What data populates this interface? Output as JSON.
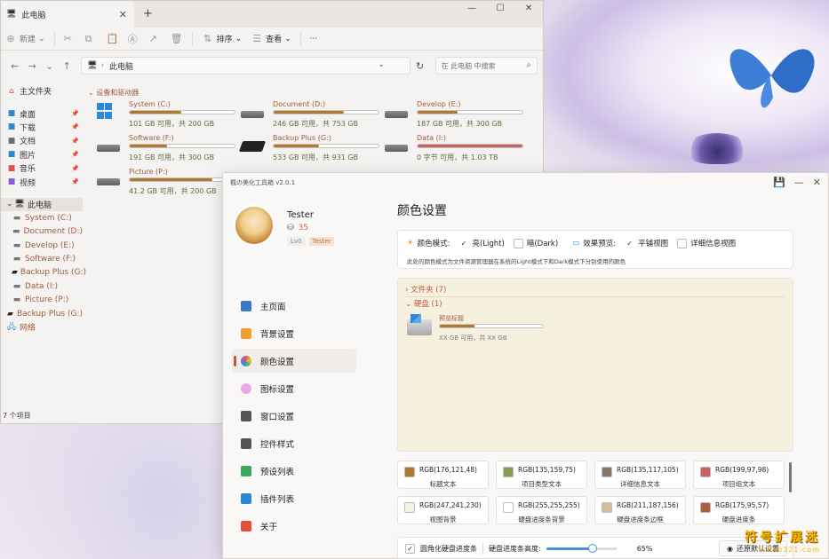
{
  "explorer": {
    "tab_title": "此电脑",
    "new_tab": "+",
    "close": "✕",
    "toolbar": {
      "new_label": "新建",
      "sort_label": "排序",
      "view_label": "查看",
      "more": "···"
    },
    "address": "此电脑",
    "search_placeholder": "在 此电脑 中搜索",
    "sidebar": {
      "home": "主文件夹",
      "quick": [
        {
          "label": "桌面",
          "icon": "desktop-icon",
          "color": "#2b88d8"
        },
        {
          "label": "下载",
          "icon": "download-icon",
          "color": "#2b88d8"
        },
        {
          "label": "文档",
          "icon": "document-icon",
          "color": "#6d6d6d"
        },
        {
          "label": "图片",
          "icon": "picture-icon",
          "color": "#2b88d8"
        },
        {
          "label": "音乐",
          "icon": "music-icon",
          "color": "#e0534a"
        },
        {
          "label": "视频",
          "icon": "video-icon",
          "color": "#8a5ad8"
        }
      ],
      "this_pc": "此电脑",
      "drives": [
        "System (C:)",
        "Document (D:)",
        "Develop (E:)",
        "Software (F:)",
        "Backup Plus (G:)",
        "Data (I:)",
        "Picture (P:)"
      ],
      "extra_drive": "Backup Plus (G:)",
      "network": "网络"
    },
    "group_header": "设备和驱动器",
    "drives": [
      {
        "name": "System (C:)",
        "size": "101 GB 可用，共 200 GB",
        "used": 0.49,
        "icon": "windows-drive-icon"
      },
      {
        "name": "Document (D:)",
        "size": "246 GB 可用，共 753 GB",
        "used": 0.67,
        "icon": "hdd-icon"
      },
      {
        "name": "Develop (E:)",
        "size": "187 GB 可用，共 300 GB",
        "used": 0.38,
        "icon": "hdd-icon"
      },
      {
        "name": "Software (F:)",
        "size": "191 GB 可用，共 300 GB",
        "used": 0.36,
        "icon": "hdd-icon"
      },
      {
        "name": "Backup Plus (G:)",
        "size": "533 GB 可用，共 931 GB",
        "used": 0.43,
        "icon": "external-disk-icon"
      },
      {
        "name": "Data (I:)",
        "size": "0 字节 可用，共 1.03 TB",
        "used": 1.0,
        "icon": "hdd-icon"
      },
      {
        "name": "Picture (P:)",
        "size": "41.2 GB 可用，共 200 GB",
        "used": 0.79,
        "icon": "hdd-icon"
      }
    ],
    "status": "7 个项目"
  },
  "tool": {
    "title": "楓の美化工具箱 v2.0.1",
    "user": {
      "name": "Tester",
      "coins": "35",
      "level": "Lv0",
      "tag": "Tester"
    },
    "menu": [
      {
        "label": "主页面",
        "icon": "home-icon",
        "color": "#3a78c8"
      },
      {
        "label": "背景设置",
        "icon": "image-icon",
        "color": "#f0a030"
      },
      {
        "label": "颜色设置",
        "icon": "color-wheel-icon",
        "color": "#e05a8a"
      },
      {
        "label": "图标设置",
        "icon": "flower-icon",
        "color": "#e8a8e8"
      },
      {
        "label": "窗口设置",
        "icon": "window-icon",
        "color": "#555555"
      },
      {
        "label": "控件样式",
        "icon": "controls-icon",
        "color": "#555555"
      },
      {
        "label": "预设列表",
        "icon": "list-icon",
        "color": "#3aa858"
      },
      {
        "label": "插件列表",
        "icon": "plugin-icon",
        "color": "#2b88d8"
      },
      {
        "label": "关于",
        "icon": "info-icon",
        "color": "#e0533a"
      }
    ],
    "selected_menu": 2,
    "page_title": "颜色设置",
    "options": {
      "mode_label": "颜色模式:",
      "light_label": "亮(Light)",
      "dark_label": "暗(Dark)",
      "preview_label": "效果预览:",
      "flat_label": "平铺视图",
      "detail_label": "详细信息视图",
      "description": "此处的颜色模式为文件资源管理器在系统的Light模式下和Dark模式下分别使用的颜色"
    },
    "preview": {
      "folders": "文件夹 (7)",
      "disks": "硬盘 (1)",
      "drive_name": "预览标题",
      "drive_size": "XX GB 可用，共 XX GB",
      "drive_used": 0.34
    },
    "swatches": [
      {
        "rgb": "RGB(176,121,48)",
        "name": "标题文本",
        "color": "#b07930"
      },
      {
        "rgb": "RGB(135,159,75)",
        "name": "项目类型文本",
        "color": "#879f4b"
      },
      {
        "rgb": "RGB(135,117,105)",
        "name": "详细信息文本",
        "color": "#877569"
      },
      {
        "rgb": "RGB(199,97,98)",
        "name": "项目组文本",
        "color": "#c76162"
      },
      {
        "rgb": "RGB(247,241,230)",
        "name": "视图背景",
        "color": "#f7f1e6"
      },
      {
        "rgb": "RGB(255,255,255)",
        "name": "硬盘进度条背景",
        "color": "#ffffff"
      },
      {
        "rgb": "RGB(211,187,156)",
        "name": "硬盘进度条边框",
        "color": "#d3bb9c"
      },
      {
        "rgb": "RGB(175,95,57)",
        "name": "硬盘进度条",
        "color": "#af5f39"
      }
    ],
    "bottom": {
      "round_label": "圆角化硬盘进度条",
      "height_label": "硬盘进度条高度:",
      "height_value": 0.65,
      "height_text": "65%",
      "reset_label": "还原默认设置"
    }
  },
  "watermark": {
    "main": "符号扩展迷",
    "sub": "fuhao321.com"
  }
}
